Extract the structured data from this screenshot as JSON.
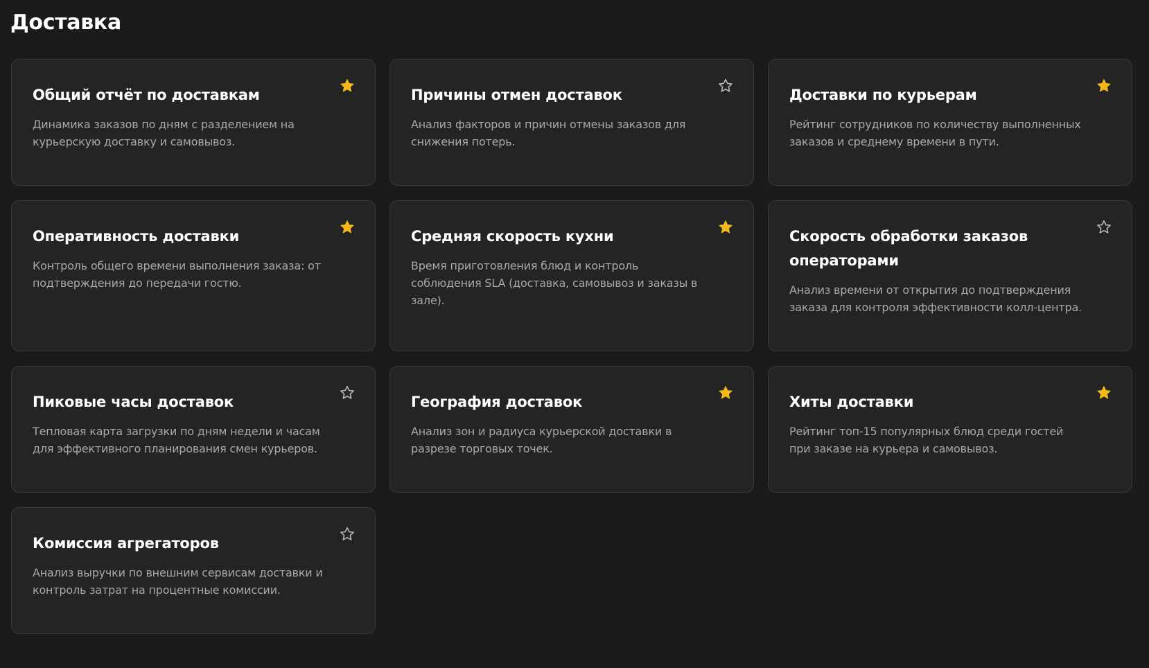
{
  "page": {
    "title": "Доставка"
  },
  "colors": {
    "background": "#1b1b1c",
    "card": "#242425",
    "card_border": "#3a3a3c",
    "star_active": "#f5b81c",
    "star_inactive": "#b8b8bc",
    "description": "#a8a8ad"
  },
  "cards": [
    {
      "title": "Общий отчёт по доставкам",
      "description": "Динамика заказов по дням с разделением на курьерскую доставку и самовывоз.",
      "favorite": true,
      "icon": "star-icon"
    },
    {
      "title": "Причины отмен доставок",
      "description": "Анализ факторов и причин отмены заказов для снижения потерь.",
      "favorite": false,
      "icon": "star-icon"
    },
    {
      "title": "Доставки по курьерам",
      "description": "Рейтинг сотрудников по количеству выполненных заказов и среднему времени в пути.",
      "favorite": true,
      "icon": "star-icon"
    },
    {
      "title": "Оперативность доставки",
      "description": "Контроль общего времени выполнения заказа: от подтверждения до передачи гостю.",
      "favorite": true,
      "icon": "star-icon"
    },
    {
      "title": "Средняя скорость кухни",
      "description": "Время приготовления блюд и контроль соблюдения SLA (доставка, самовывоз и заказы в зале).",
      "favorite": true,
      "icon": "star-icon"
    },
    {
      "title": "Скорость обработки заказов операторами",
      "description": "Анализ времени от открытия до подтверждения заказа для контроля эффективности колл-центра.",
      "favorite": false,
      "icon": "star-icon"
    },
    {
      "title": "Пиковые часы доставок",
      "description": "Тепловая карта загрузки по дням недели и часам для эффективного планирования смен курьеров.",
      "favorite": false,
      "icon": "star-icon"
    },
    {
      "title": "География доставок",
      "description": "Анализ зон и радиуса курьерской доставки в разрезе торговых точек.",
      "favorite": true,
      "icon": "star-icon"
    },
    {
      "title": "Хиты доставки",
      "description": "Рейтинг топ-15 популярных блюд среди гостей при заказе на курьера и самовывоз.",
      "favorite": true,
      "icon": "star-icon"
    },
    {
      "title": "Комиссия агрегаторов",
      "description": "Анализ выручки по внешним сервисам доставки и контроль затрат на процентные комиссии.",
      "favorite": false,
      "icon": "star-icon"
    }
  ]
}
